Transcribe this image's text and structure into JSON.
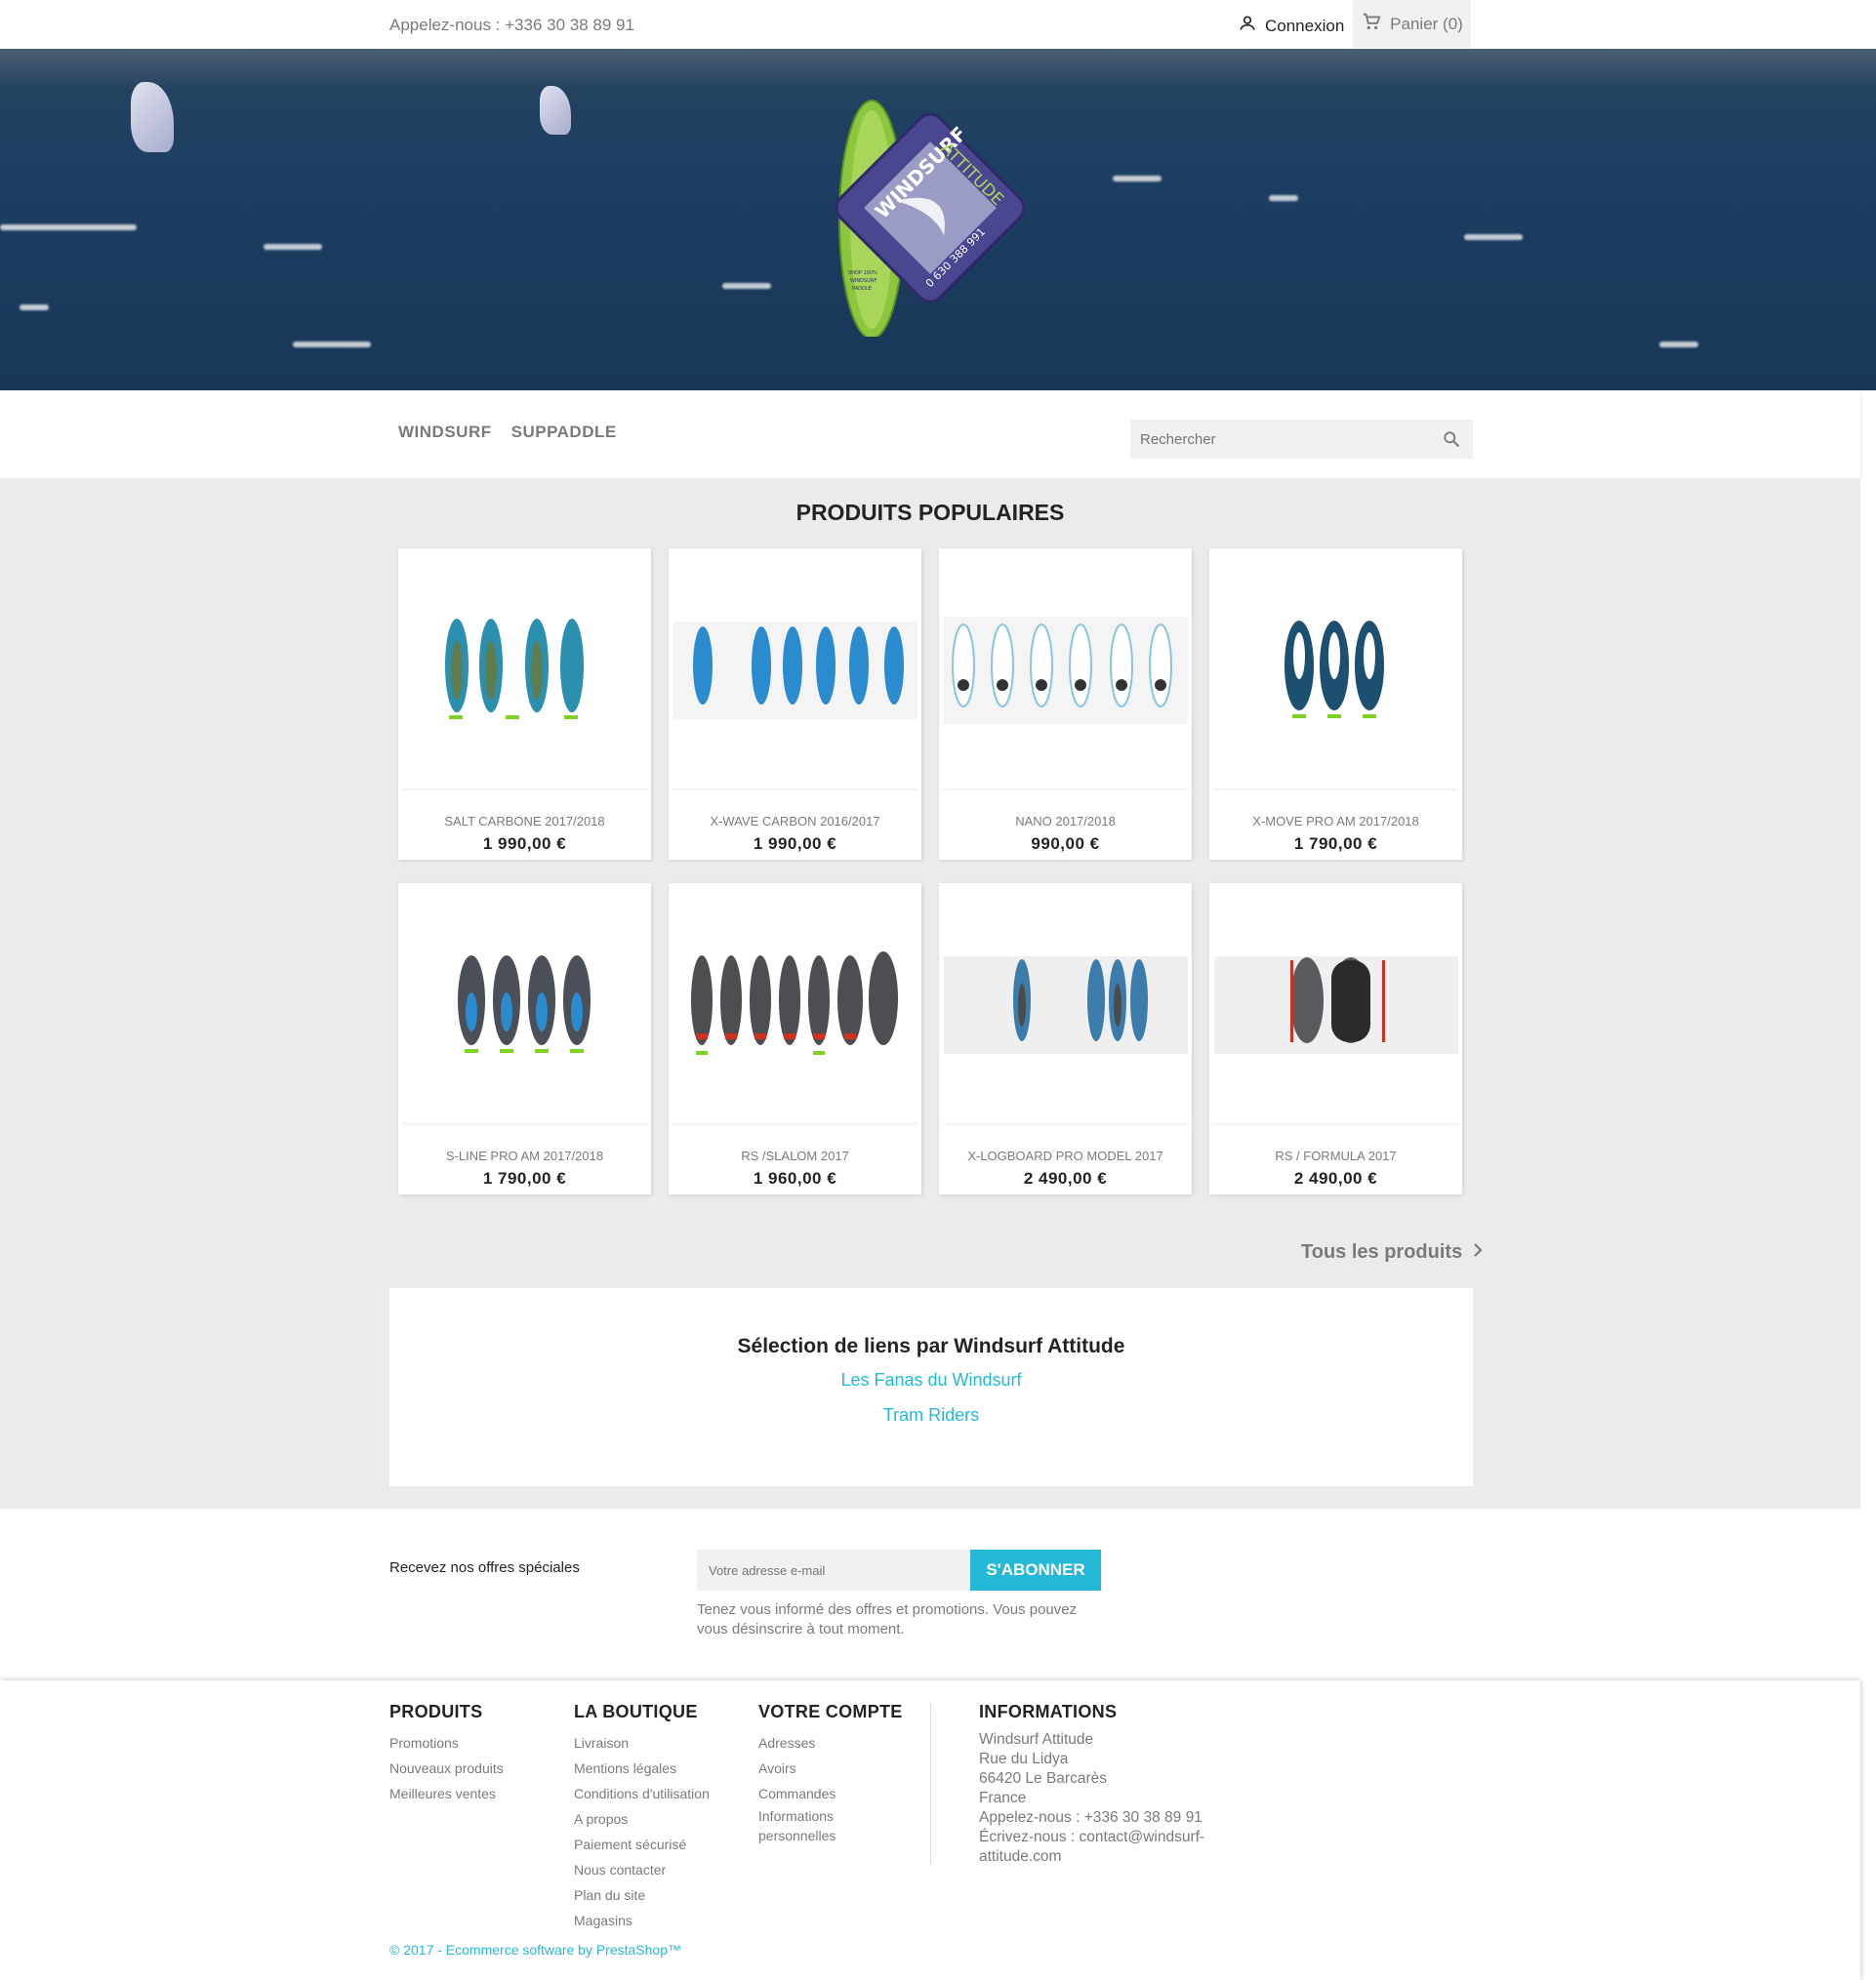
{
  "header": {
    "phone": "Appelez-nous : +336 30 38 89 91",
    "login": "Connexion",
    "cart": "Panier (0)"
  },
  "logo": {
    "brand": "WINDSURF ATTITUDE",
    "phone": "0 630 388 991",
    "tagline": "SHOP 100% WINDSURF PADDLE"
  },
  "nav": {
    "items": [
      "WINDSURF",
      "SUPPADDLE"
    ],
    "search_placeholder": "Rechercher"
  },
  "popular": {
    "title": "PRODUITS POPULAIRES",
    "products": [
      {
        "name": "SALT CARBONE 2017/2018",
        "price": "1 990,00 €"
      },
      {
        "name": "X-WAVE CARBON 2016/2017",
        "price": "1 990,00 €"
      },
      {
        "name": "NANO 2017/2018",
        "price": "990,00 €"
      },
      {
        "name": "X-MOVE PRO AM 2017/2018",
        "price": "1 790,00 €"
      },
      {
        "name": "S-LINE PRO AM 2017/2018",
        "price": "1 790,00 €"
      },
      {
        "name": "RS /SLALOM 2017",
        "price": "1 960,00 €"
      },
      {
        "name": "X-LOGBOARD PRO MODEL 2017",
        "price": "2 490,00 €"
      },
      {
        "name": "RS / FORMULA 2017",
        "price": "2 490,00 €"
      }
    ],
    "all_products": "Tous les produits"
  },
  "links": {
    "title": "Sélection de liens par Windsurf Attitude",
    "items": [
      "Les Fanas du Windsurf",
      "Tram Riders"
    ]
  },
  "newsletter": {
    "label": "Recevez nos offres spéciales",
    "placeholder": "Votre adresse e-mail",
    "button": "S'ABONNER",
    "note": "Tenez vous informé des offres et promotions. Vous pouvez vous désinscrire à tout moment."
  },
  "footer": {
    "produits": {
      "title": "PRODUITS",
      "items": [
        "Promotions",
        "Nouveaux produits",
        "Meilleures ventes"
      ]
    },
    "boutique": {
      "title": "LA BOUTIQUE",
      "items": [
        "Livraison",
        "Mentions légales",
        "Conditions d'utilisation",
        "A propos",
        "Paiement sécurisé",
        "Nous contacter",
        "Plan du site",
        "Magasins"
      ]
    },
    "compte": {
      "title": "VOTRE COMPTE",
      "items": [
        "Adresses",
        "Avoirs",
        "Commandes",
        "Informations",
        "personnelles"
      ]
    },
    "informations": {
      "title": "INFORMATIONS",
      "lines": [
        "Windsurf Attitude",
        "Rue du Lidya",
        "66420 Le Barcarès",
        "France",
        "Appelez-nous : +336 30 38 89 91",
        "Écrivez-nous : contact@windsurf-",
        "attitude.com"
      ]
    },
    "copyright": "© 2017 - Ecommerce software by PrestaShop™"
  },
  "colors": {
    "accent": "#24b9d7",
    "background": "#ebebeb",
    "dark_text": "#232323",
    "muted_text": "#7a7a7a"
  }
}
